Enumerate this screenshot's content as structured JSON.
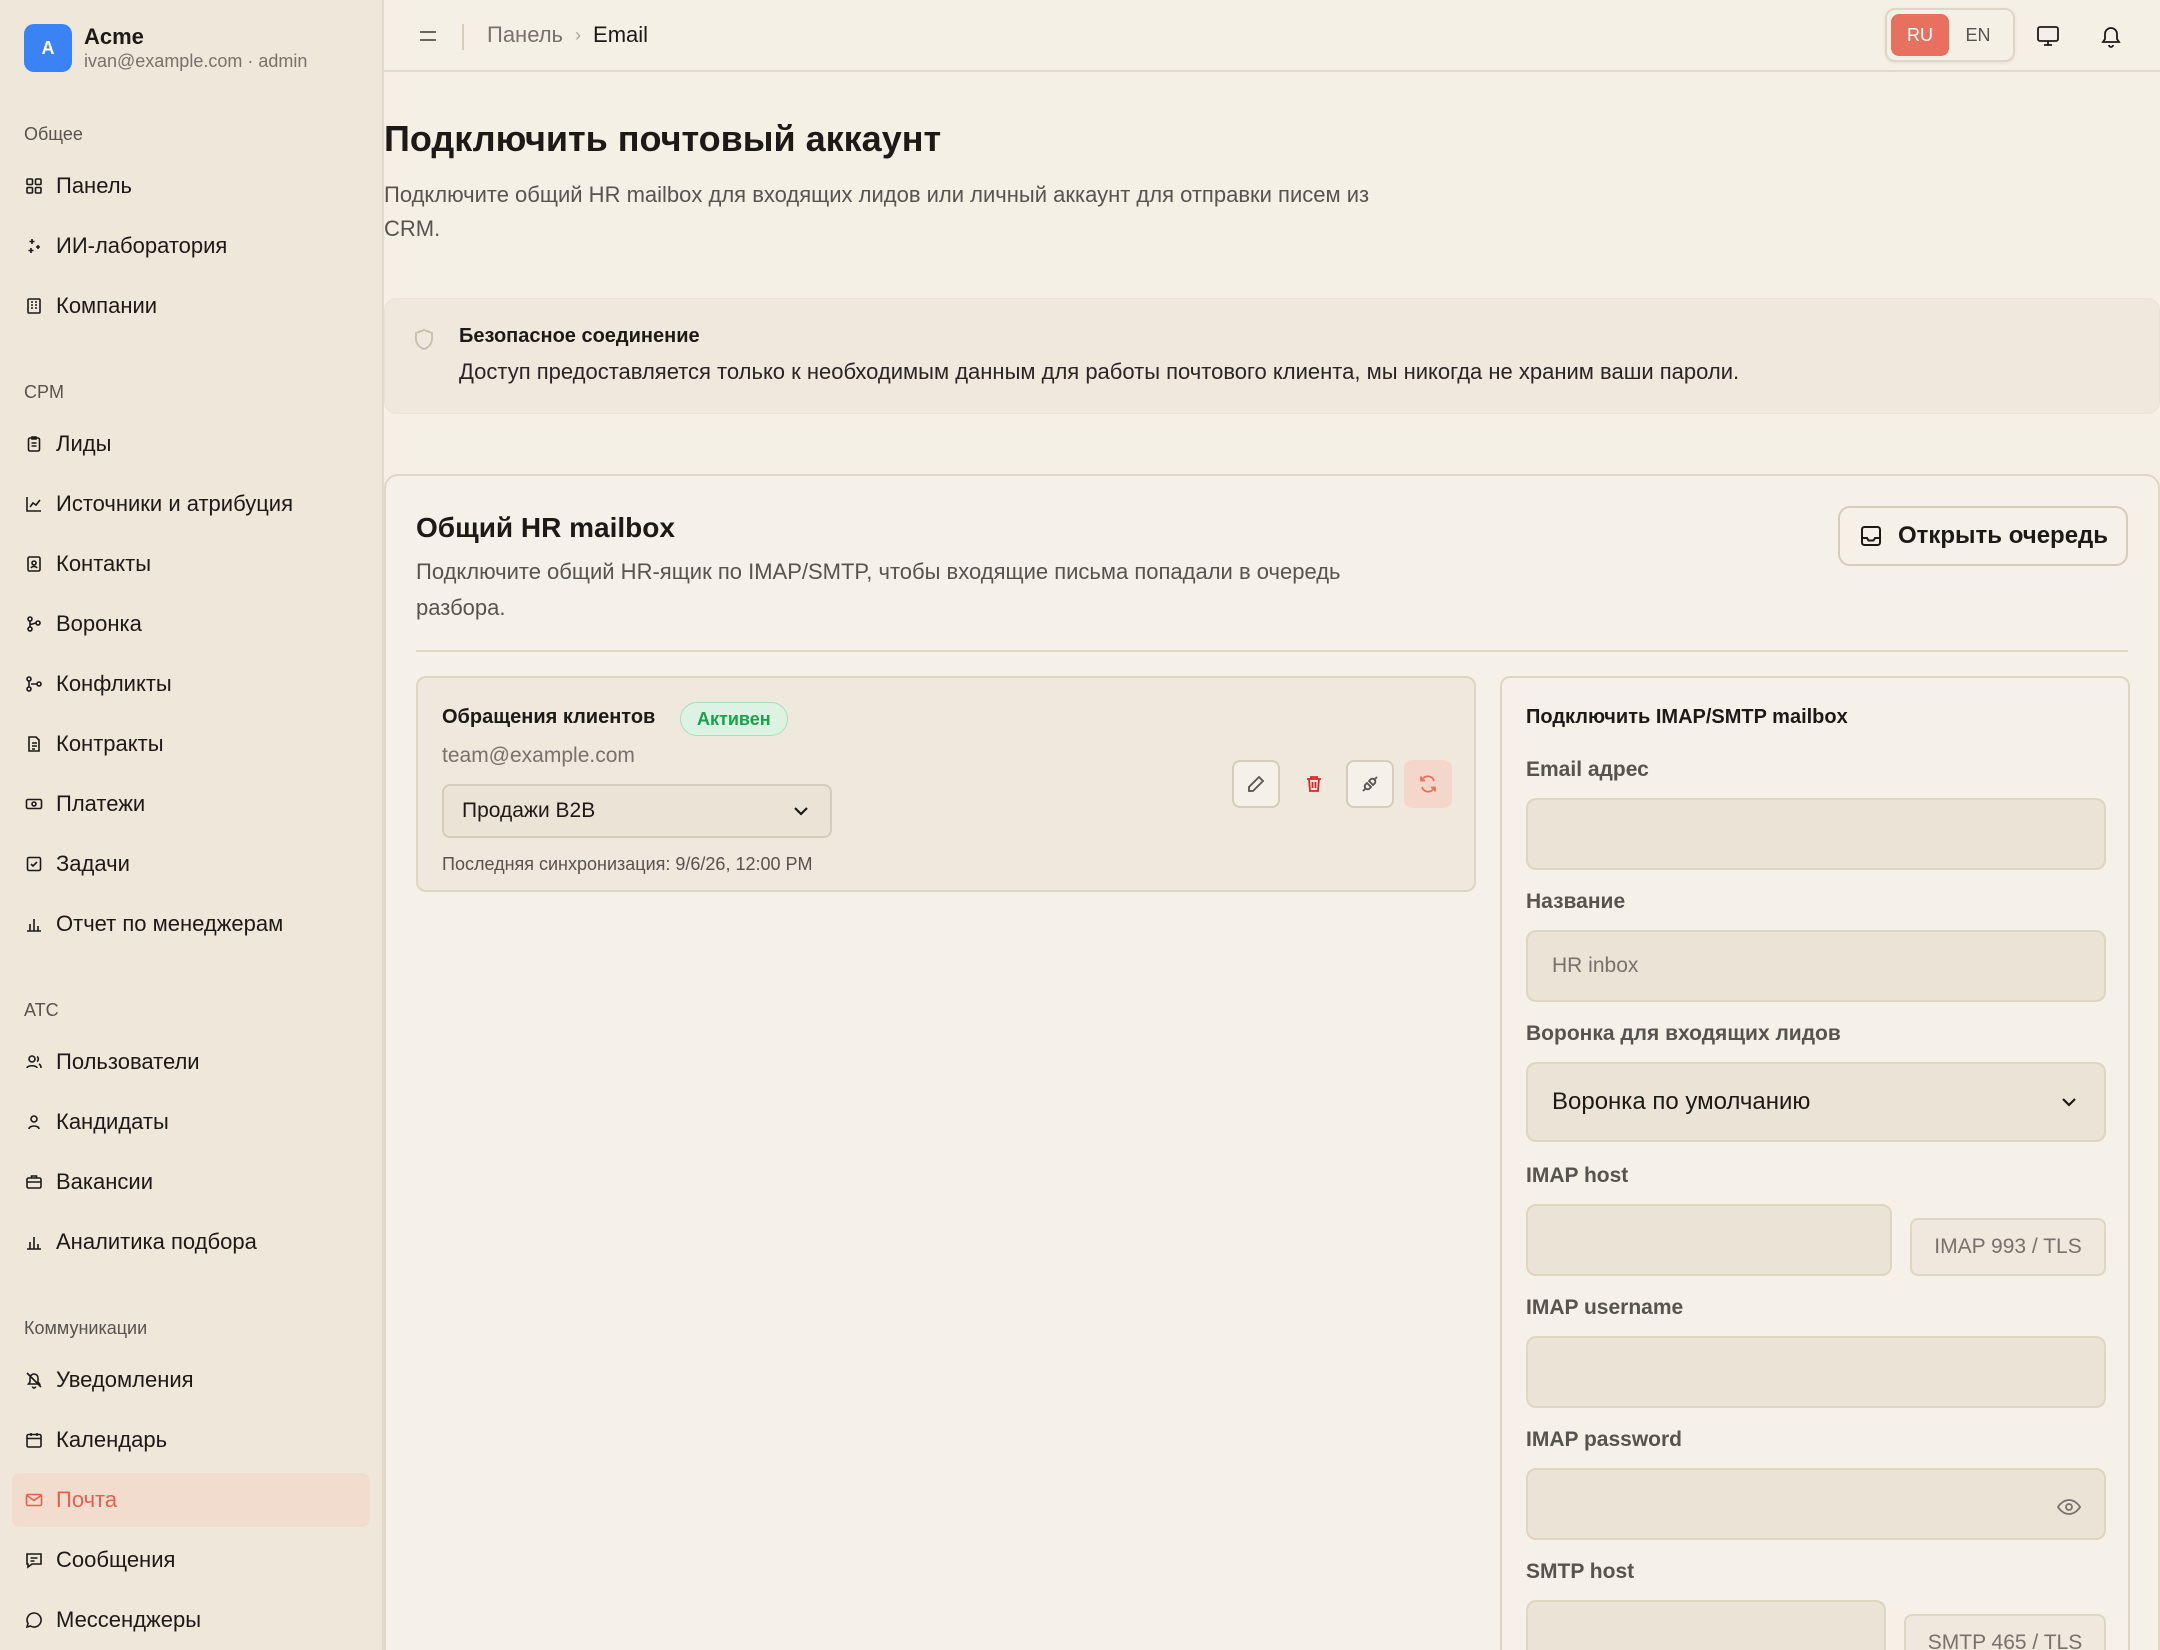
{
  "brand": {
    "initial": "A",
    "name": "Acme",
    "subtitle": "ivan@example.com · admin"
  },
  "sidebar": {
    "sections": [
      {
        "title": "Общее",
        "items": [
          "Панель",
          "ИИ-лаборатория",
          "Компании"
        ]
      },
      {
        "title": "CPM",
        "items": [
          "Лиды",
          "Источники и атрибуция",
          "Контакты",
          "Воронка",
          "Конфликты",
          "Контракты",
          "Платежи",
          "Задачи",
          "Отчет по менеджерам"
        ]
      },
      {
        "title": "ATC",
        "items": [
          "Пользователи",
          "Кандидаты",
          "Вакансии",
          "Аналитика подбора"
        ]
      },
      {
        "title": "Коммуникации",
        "items": [
          "Уведомления",
          "Календарь",
          "Почта",
          "Сообщения",
          "Мессенджеры"
        ]
      }
    ],
    "active": "Почта"
  },
  "topbar": {
    "breadcrumb_home": "Панель",
    "breadcrumb_current": "Email",
    "lang_ru": "RU",
    "lang_en": "EN",
    "active_lang": "RU"
  },
  "page": {
    "title": "Подключить почтовый аккаунт",
    "description": "Подключите общий HR mailbox для входящих лидов или личный аккаунт для отправки писем из CRM."
  },
  "secure": {
    "title": "Безопасное соединение",
    "text": "Доступ предоставляется только к необходимым данным для работы почтового клиента, мы никогда не храним ваши пароли."
  },
  "card": {
    "title": "Общий HR mailbox",
    "description": "Подключите общий HR-ящик по IMAP/SMTP, чтобы входящие письма попадали в очередь разбора.",
    "queue_button": "Открыть очередь"
  },
  "mailbox": {
    "name": "Обращения клиентов",
    "status": "Активен",
    "email": "team@example.com",
    "pipeline": "Продажи B2B",
    "last_sync": "Последняя синхронизация: 9/6/26, 12:00 PM"
  },
  "form": {
    "title": "Подключить IMAP/SMTP mailbox",
    "email_label": "Email адрес",
    "email_value": "",
    "name_label": "Название",
    "name_placeholder": "HR inbox",
    "pipeline_label": "Воронка для входящих лидов",
    "pipeline_value": "Воронка по умолчанию",
    "imap_host_label": "IMAP host",
    "imap_port": "IMAP 993 / TLS",
    "imap_user_label": "IMAP username",
    "imap_pass_label": "IMAP password",
    "smtp_host_label": "SMTP host",
    "smtp_port": "SMTP 465 / TLS"
  },
  "colors": {
    "accent": "#e8705f",
    "active_bg": "#f1dccd",
    "success": "#16a34a",
    "brand_avatar": "#3b82f6"
  }
}
